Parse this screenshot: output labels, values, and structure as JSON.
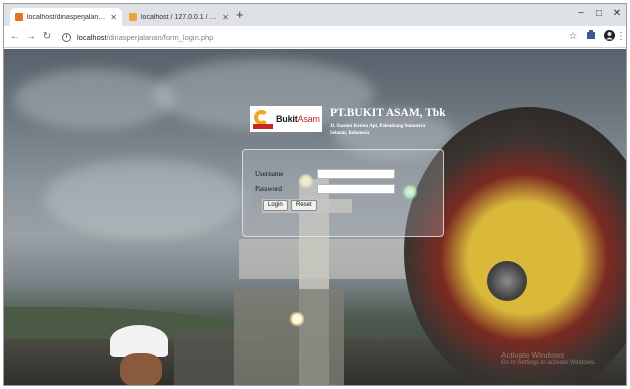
{
  "browser": {
    "tabs": [
      {
        "title": "localhost/dinasperjalanan/form_",
        "favicon_color": "#e8711f",
        "active": true
      },
      {
        "title": "localhost / 127.0.0.1 / suratpdi",
        "favicon_color": "#f0a33a",
        "active": false
      }
    ],
    "new_tab_label": "+",
    "window_controls": {
      "minimize": "−",
      "maximize": "□",
      "close": "✕"
    },
    "address": {
      "host": "localhost",
      "path": "/dinasperjalanan/form_login.php"
    },
    "icons": [
      "back-arrow-icon",
      "forward-arrow-icon",
      "reload-icon",
      "info-icon",
      "star-icon",
      "extension-icon",
      "profile-icon",
      "menu-icon"
    ]
  },
  "brand": {
    "logo_text_primary": "Bukit",
    "logo_text_secondary": "Asam",
    "company_name": "PT.BUKIT ASAM, Tbk",
    "address": "Jl. Stasiun Kereta Api, Palembang Sumatera Selatan, Indonesia"
  },
  "login": {
    "username_label": "Username",
    "password_label": "Password",
    "username_value": "",
    "password_value": "",
    "login_button": "Login",
    "reset_button": "Reset"
  },
  "windows_watermark": {
    "line1": "Activate Windows",
    "line2": "Go to Settings to activate Windows."
  },
  "colors": {
    "brand_orange": "#f3a51c",
    "brand_red": "#c62828"
  }
}
